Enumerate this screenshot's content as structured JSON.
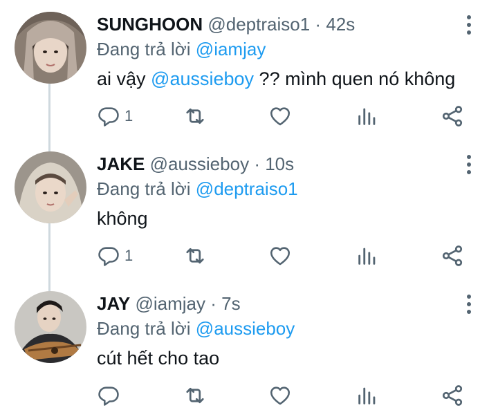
{
  "tweets": [
    {
      "name": "SUNGHOON",
      "handle": "@deptraiso1",
      "separator": "·",
      "time": "42s",
      "replying_label": "Đang trả lời",
      "replying_to": "@iamjay",
      "text_before": "ai vậy ",
      "text_mention": "@aussieboy",
      "text_after": " ?? mình quen nó không",
      "reply_count": "1"
    },
    {
      "name": "JAKE",
      "handle": "@aussieboy",
      "separator": "·",
      "time": "10s",
      "replying_label": "Đang trả lời",
      "replying_to": "@deptraiso1",
      "text_before": "không",
      "text_mention": "",
      "text_after": "",
      "reply_count": "1"
    },
    {
      "name": "JAY",
      "handle": "@iamjay",
      "separator": "·",
      "time": "7s",
      "replying_label": "Đang trả lời",
      "replying_to": "@aussieboy",
      "text_before": "cút hết cho tao",
      "text_mention": "",
      "text_after": "",
      "reply_count": ""
    }
  ],
  "icons": {
    "reply": "reply-icon",
    "retweet": "retweet-icon",
    "like": "heart-icon",
    "views": "views-icon",
    "share": "share-icon",
    "more": "more-vertical-icon"
  },
  "colors": {
    "text": "#0f1419",
    "secondary": "#536471",
    "mention": "#1d9bf0",
    "thread_line": "#cfd9de"
  }
}
